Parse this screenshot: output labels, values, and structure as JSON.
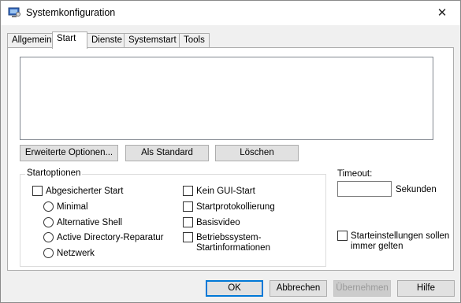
{
  "window": {
    "title": "Systemkonfiguration",
    "close_symbol": "✕"
  },
  "tabs": [
    {
      "label": "Allgemein",
      "active": false
    },
    {
      "label": "Start",
      "active": true
    },
    {
      "label": "Dienste",
      "active": false
    },
    {
      "label": "Systemstart",
      "active": false
    },
    {
      "label": "Tools",
      "active": false
    }
  ],
  "boot_list": {
    "entries": []
  },
  "boot_buttons": {
    "advanced": "Erweiterte Optionen...",
    "set_default": "Als Standard",
    "delete": "Löschen"
  },
  "boot_options": {
    "group_label": "Startoptionen",
    "safe_boot": {
      "label": "Abgesicherter Start",
      "checked": false
    },
    "radios": [
      {
        "label": "Minimal",
        "checked": false
      },
      {
        "label": "Alternative Shell",
        "checked": false
      },
      {
        "label": "Active Directory-Reparatur",
        "checked": false
      },
      {
        "label": "Netzwerk",
        "checked": false
      }
    ],
    "no_gui_boot": {
      "label": "Kein GUI-Start",
      "checked": false
    },
    "boot_log": {
      "label": "Startprotokollierung",
      "checked": false
    },
    "base_video": {
      "label": "Basisvideo",
      "checked": false
    },
    "os_boot_info": {
      "label_line1": "Betriebssystem-",
      "label_line2": "Startinformationen",
      "checked": false
    }
  },
  "timeout": {
    "label": "Timeout:",
    "value": "",
    "unit": "Sekunden"
  },
  "permanent": {
    "label_line1": "Starteinstellungen sollen",
    "label_line2": "immer gelten",
    "checked": false
  },
  "dialog_buttons": {
    "ok": "OK",
    "cancel": "Abbrechen",
    "apply": "Übernehmen",
    "help": "Hilfe"
  },
  "colors": {
    "accent": "#0078d7",
    "window_bg": "#f0f0f0",
    "panel_bg": "#ffffff"
  },
  "icons": {
    "app": "msconfig-computer-icon",
    "close": "close-icon"
  }
}
